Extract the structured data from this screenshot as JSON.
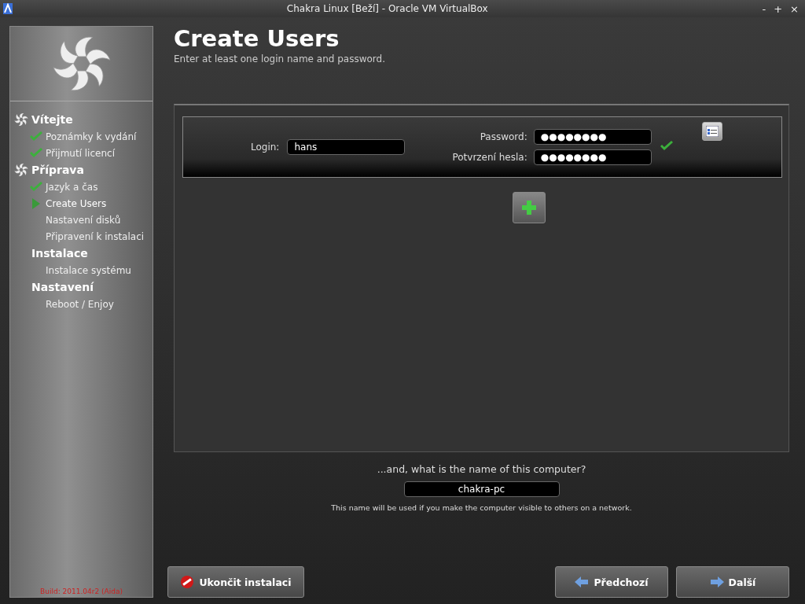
{
  "window": {
    "title": "Chakra Linux [Beží] - Oracle VM VirtualBox",
    "controls": [
      "-",
      "+",
      "×"
    ]
  },
  "sidebar": {
    "groups": [
      {
        "label": "Vítejte",
        "kind": "icon",
        "children": [
          {
            "label": "Poznámky k vydání",
            "done": true,
            "selected": false
          },
          {
            "label": "Přijmutí licencí",
            "done": true,
            "selected": false
          }
        ]
      },
      {
        "label": "Příprava",
        "kind": "icon",
        "children": [
          {
            "label": "Jazyk a čas",
            "done": true,
            "selected": false
          },
          {
            "label": "Create Users",
            "done": false,
            "selected": true
          },
          {
            "label": "Nastavení disků",
            "done": false,
            "selected": false
          },
          {
            "label": "Připravení k instalaci",
            "done": false,
            "selected": false
          }
        ]
      },
      {
        "label": "Instalace",
        "kind": "plain",
        "children": [
          {
            "label": "Instalace systému",
            "done": false,
            "selected": false
          }
        ]
      },
      {
        "label": "Nastavení",
        "kind": "plain",
        "children": [
          {
            "label": "Reboot / Enjoy",
            "done": false,
            "selected": false
          }
        ]
      }
    ],
    "build": "Build: 2011.04r2 (Aida)"
  },
  "header": {
    "title": "Create Users",
    "subtitle": "Enter at least one login name and password."
  },
  "user": {
    "login_label": "Login:",
    "login": "hans",
    "password_label": "Password:",
    "password": "●●●●●●●●",
    "confirm_label": "Potvrzení hesla:",
    "confirm": "●●●●●●●●",
    "valid": true
  },
  "hostname": {
    "question": "...and, what is the name of this computer?",
    "value": "chakra-pc",
    "hint": "This name will be used if you make the computer visible to others on a network."
  },
  "buttons": [
    {
      "label": "Ukončit instalaci",
      "kind": "cancel"
    },
    {
      "label": "Předchozí",
      "kind": "back"
    },
    {
      "label": "Další",
      "kind": "next"
    }
  ]
}
